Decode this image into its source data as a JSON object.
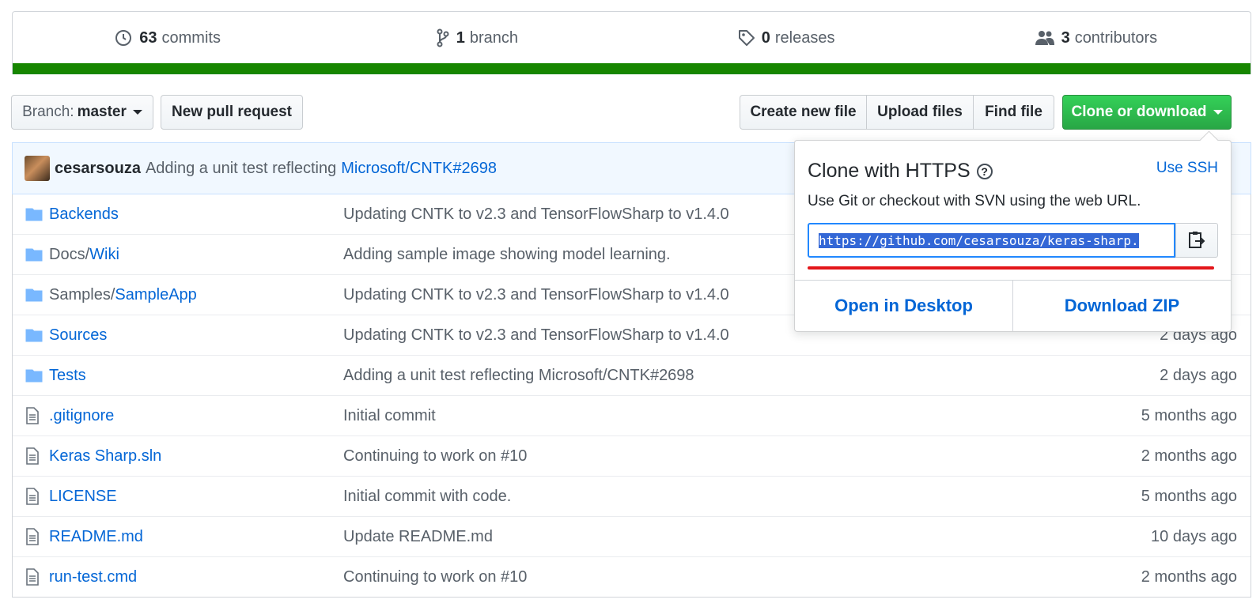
{
  "numbers": {
    "commits": {
      "count": "63",
      "label": "commits"
    },
    "branches": {
      "count": "1",
      "label": "branch"
    },
    "releases": {
      "count": "0",
      "label": "releases"
    },
    "contributors": {
      "count": "3",
      "label": "contributors"
    },
    "language_color": "#178600"
  },
  "toolbar": {
    "branch_label": "Branch:",
    "branch_value": "master",
    "new_pull_request": "New pull request",
    "create_new_file": "Create new file",
    "upload_files": "Upload files",
    "find_file": "Find file",
    "clone_or_download": "Clone or download"
  },
  "commit": {
    "author": "cesarsouza",
    "message": "Adding a unit test reflecting",
    "link": "Microsoft/CNTK#2698"
  },
  "files": [
    {
      "type": "folder",
      "prefix": "",
      "name": "Backends",
      "message": "Updating CNTK to v2.3 and TensorFlowSharp to v1.4.0",
      "age": ""
    },
    {
      "type": "folder",
      "prefix": "Docs/",
      "name": "Wiki",
      "message": "Adding sample image showing model learning.",
      "age": ""
    },
    {
      "type": "folder",
      "prefix": "Samples/",
      "name": "SampleApp",
      "message": "Updating CNTK to v2.3 and TensorFlowSharp to v1.4.0",
      "age": ""
    },
    {
      "type": "folder",
      "prefix": "",
      "name": "Sources",
      "message": "Updating CNTK to v2.3 and TensorFlowSharp to v1.4.0",
      "age": "2 days ago"
    },
    {
      "type": "folder",
      "prefix": "",
      "name": "Tests",
      "message": "Adding a unit test reflecting Microsoft/CNTK#2698",
      "age": "2 days ago"
    },
    {
      "type": "file",
      "prefix": "",
      "name": ".gitignore",
      "message": "Initial commit",
      "age": "5 months ago"
    },
    {
      "type": "file",
      "prefix": "",
      "name": "Keras Sharp.sln",
      "message": "Continuing to work on #10",
      "age": "2 months ago"
    },
    {
      "type": "file",
      "prefix": "",
      "name": "LICENSE",
      "message": "Initial commit with code.",
      "age": "5 months ago"
    },
    {
      "type": "file",
      "prefix": "",
      "name": "README.md",
      "message": "Update README.md",
      "age": "10 days ago"
    },
    {
      "type": "file",
      "prefix": "",
      "name": "run-test.cmd",
      "message": "Continuing to work on #10",
      "age": "2 months ago"
    }
  ],
  "clone_popup": {
    "title": "Clone with HTTPS",
    "use_ssh": "Use SSH",
    "description": "Use Git or checkout with SVN using the web URL.",
    "url": "https://github.com/cesarsouza/keras-sharp.",
    "open_desktop": "Open in Desktop",
    "download_zip": "Download ZIP"
  }
}
